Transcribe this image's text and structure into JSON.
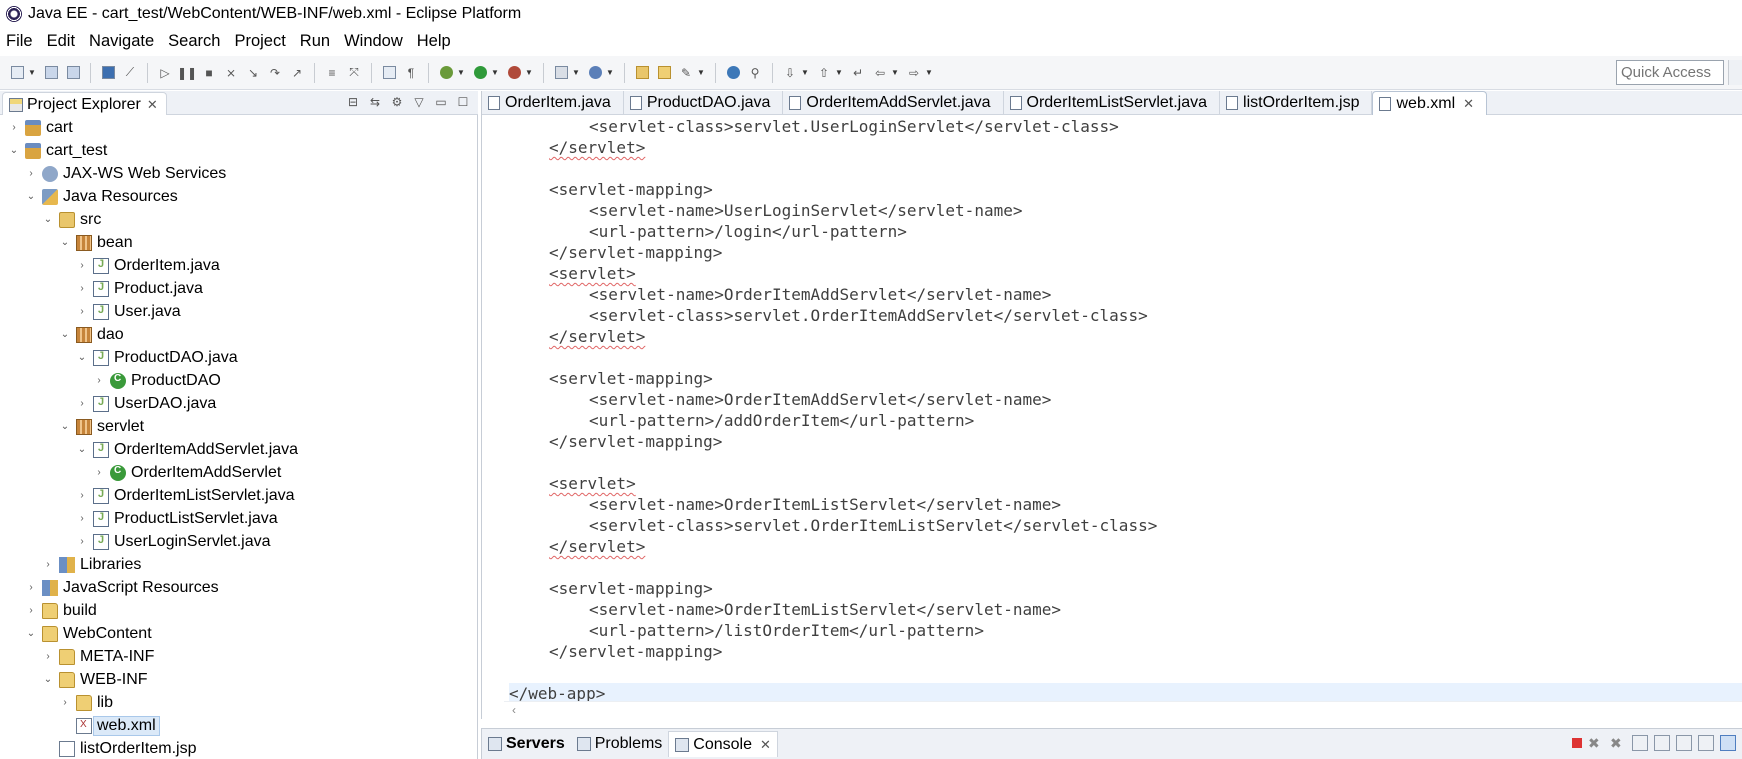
{
  "window": {
    "title": "Java EE - cart_test/WebContent/WEB-INF/web.xml - Eclipse Platform"
  },
  "menu": [
    {
      "label": "File",
      "mnemonic": "F",
      "rest": "ile"
    },
    {
      "label": "Edit",
      "mnemonic": "E",
      "rest": "dit"
    },
    {
      "label": "Navigate",
      "mnemonic": "N",
      "rest": "avigate"
    },
    {
      "label": "Search",
      "mnemonic": "",
      "rest": "Search"
    },
    {
      "label": "Project",
      "mnemonic": "P",
      "rest": "roject"
    },
    {
      "label": "Run",
      "mnemonic": "R",
      "rest": "un"
    },
    {
      "label": "Window",
      "mnemonic": "W",
      "rest": "indow"
    },
    {
      "label": "Help",
      "mnemonic": "H",
      "rest": "elp"
    }
  ],
  "toolbar": {
    "quick_access_placeholder": "Quick Access"
  },
  "explorer": {
    "tab_label": "Project Explorer",
    "tree": [
      {
        "label": "cart",
        "level": 0,
        "twisty": "›",
        "icon": "project-icon",
        "kind": "project"
      },
      {
        "label": "cart_test",
        "level": 0,
        "twisty": "⌄",
        "icon": "project-icon",
        "kind": "project"
      },
      {
        "label": "JAX-WS Web Services",
        "level": 1,
        "twisty": "›",
        "icon": "webservices-icon",
        "kind": "ws"
      },
      {
        "label": "Java Resources",
        "level": 1,
        "twisty": "⌄",
        "icon": "java-resources-icon",
        "kind": "javares"
      },
      {
        "label": "src",
        "level": 2,
        "twisty": "⌄",
        "icon": "source-folder-icon",
        "kind": "srcfolder"
      },
      {
        "label": "bean",
        "level": 3,
        "twisty": "⌄",
        "icon": "package-icon",
        "kind": "package"
      },
      {
        "label": "OrderItem.java",
        "level": 4,
        "twisty": "›",
        "icon": "java-file-icon",
        "kind": "javafile"
      },
      {
        "label": "Product.java",
        "level": 4,
        "twisty": "›",
        "icon": "java-file-icon",
        "kind": "javafile"
      },
      {
        "label": "User.java",
        "level": 4,
        "twisty": "›",
        "icon": "java-file-icon",
        "kind": "javafile"
      },
      {
        "label": "dao",
        "level": 3,
        "twisty": "⌄",
        "icon": "package-icon",
        "kind": "package"
      },
      {
        "label": "ProductDAO.java",
        "level": 4,
        "twisty": "⌄",
        "icon": "java-file-icon",
        "kind": "javafile"
      },
      {
        "label": "ProductDAO",
        "level": 5,
        "twisty": "›",
        "icon": "class-icon",
        "kind": "class"
      },
      {
        "label": "UserDAO.java",
        "level": 4,
        "twisty": "›",
        "icon": "java-file-icon",
        "kind": "javafile"
      },
      {
        "label": "servlet",
        "level": 3,
        "twisty": "⌄",
        "icon": "package-icon",
        "kind": "package"
      },
      {
        "label": "OrderItemAddServlet.java",
        "level": 4,
        "twisty": "⌄",
        "icon": "java-file-icon",
        "kind": "javafile"
      },
      {
        "label": "OrderItemAddServlet",
        "level": 5,
        "twisty": "›",
        "icon": "class-icon",
        "kind": "class"
      },
      {
        "label": "OrderItemListServlet.java",
        "level": 4,
        "twisty": "›",
        "icon": "java-file-icon",
        "kind": "javafile"
      },
      {
        "label": "ProductListServlet.java",
        "level": 4,
        "twisty": "›",
        "icon": "java-file-icon",
        "kind": "javafile"
      },
      {
        "label": "UserLoginServlet.java",
        "level": 4,
        "twisty": "›",
        "icon": "java-file-icon",
        "kind": "javafile"
      },
      {
        "label": "Libraries",
        "level": 2,
        "twisty": "›",
        "icon": "libraries-icon",
        "kind": "libs"
      },
      {
        "label": "JavaScript Resources",
        "level": 1,
        "twisty": "›",
        "icon": "javascript-resources-icon",
        "kind": "libs"
      },
      {
        "label": "build",
        "level": 1,
        "twisty": "›",
        "icon": "folder-icon",
        "kind": "folder"
      },
      {
        "label": "WebContent",
        "level": 1,
        "twisty": "⌄",
        "icon": "folder-icon",
        "kind": "folder"
      },
      {
        "label": "META-INF",
        "level": 2,
        "twisty": "›",
        "icon": "folder-icon",
        "kind": "folder"
      },
      {
        "label": "WEB-INF",
        "level": 2,
        "twisty": "⌄",
        "icon": "folder-icon",
        "kind": "folder"
      },
      {
        "label": "lib",
        "level": 3,
        "twisty": "›",
        "icon": "folder-icon",
        "kind": "folder"
      },
      {
        "label": "web.xml",
        "level": 3,
        "twisty": "",
        "icon": "xml-file-icon",
        "kind": "xmlfile",
        "selected": true
      },
      {
        "label": "listOrderItem.jsp",
        "level": 2,
        "twisty": "",
        "icon": "jsp-file-icon",
        "kind": "jspfile"
      }
    ]
  },
  "editor": {
    "tabs": [
      {
        "label": "OrderItem.java",
        "active": false
      },
      {
        "label": "ProductDAO.java",
        "active": false
      },
      {
        "label": "OrderItemAddServlet.java",
        "active": false
      },
      {
        "label": "OrderItemListServlet.java",
        "active": false
      },
      {
        "label": "listOrderItem.jsp",
        "active": false
      },
      {
        "label": "web.xml",
        "active": true
      }
    ],
    "lines": [
      {
        "indent": 2,
        "text": "<servlet-class>servlet.UserLoginServlet</servlet-class>"
      },
      {
        "indent": 1,
        "text": "</servlet>",
        "squiggle": true
      },
      {
        "indent": 0,
        "text": ""
      },
      {
        "indent": 1,
        "text": "<servlet-mapping>"
      },
      {
        "indent": 2,
        "text": "<servlet-name>UserLoginServlet</servlet-name>"
      },
      {
        "indent": 2,
        "text": "<url-pattern>/login</url-pattern>"
      },
      {
        "indent": 1,
        "text": "</servlet-mapping>"
      },
      {
        "indent": 1,
        "text": "<servlet>",
        "squiggle": true
      },
      {
        "indent": 2,
        "text": "<servlet-name>OrderItemAddServlet</servlet-name>"
      },
      {
        "indent": 2,
        "text": "<servlet-class>servlet.OrderItemAddServlet</servlet-class>"
      },
      {
        "indent": 1,
        "text": "</servlet>",
        "squiggle": true
      },
      {
        "indent": 0,
        "text": ""
      },
      {
        "indent": 1,
        "text": "<servlet-mapping>"
      },
      {
        "indent": 2,
        "text": "<servlet-name>OrderItemAddServlet</servlet-name>"
      },
      {
        "indent": 2,
        "text": "<url-pattern>/addOrderItem</url-pattern>"
      },
      {
        "indent": 1,
        "text": "</servlet-mapping>"
      },
      {
        "indent": 0,
        "text": ""
      },
      {
        "indent": 1,
        "text": "<servlet>",
        "squiggle": true
      },
      {
        "indent": 2,
        "text": "<servlet-name>OrderItemListServlet</servlet-name>"
      },
      {
        "indent": 2,
        "text": "<servlet-class>servlet.OrderItemListServlet</servlet-class>"
      },
      {
        "indent": 1,
        "text": "</servlet>",
        "squiggle": true
      },
      {
        "indent": 0,
        "text": ""
      },
      {
        "indent": 1,
        "text": "<servlet-mapping>"
      },
      {
        "indent": 2,
        "text": "<servlet-name>OrderItemListServlet</servlet-name>"
      },
      {
        "indent": 2,
        "text": "<url-pattern>/listOrderItem</url-pattern>"
      },
      {
        "indent": 1,
        "text": "</servlet-mapping>"
      },
      {
        "indent": 0,
        "text": ""
      },
      {
        "indent": 0,
        "text": "</web-app>",
        "current": true,
        "squiggle": true
      }
    ]
  },
  "bottom_panel": {
    "tabs": [
      {
        "label": "Servers",
        "bold": true,
        "active": false,
        "icon": "servers-icon"
      },
      {
        "label": "Problems",
        "bold": false,
        "active": false,
        "icon": "problems-icon"
      },
      {
        "label": "Console",
        "bold": false,
        "active": true,
        "icon": "console-icon",
        "closable": true
      }
    ]
  },
  "colors": {
    "selection": "#dbe9f8",
    "current_line": "#e8f2fe",
    "squiggle": "#e06565"
  }
}
